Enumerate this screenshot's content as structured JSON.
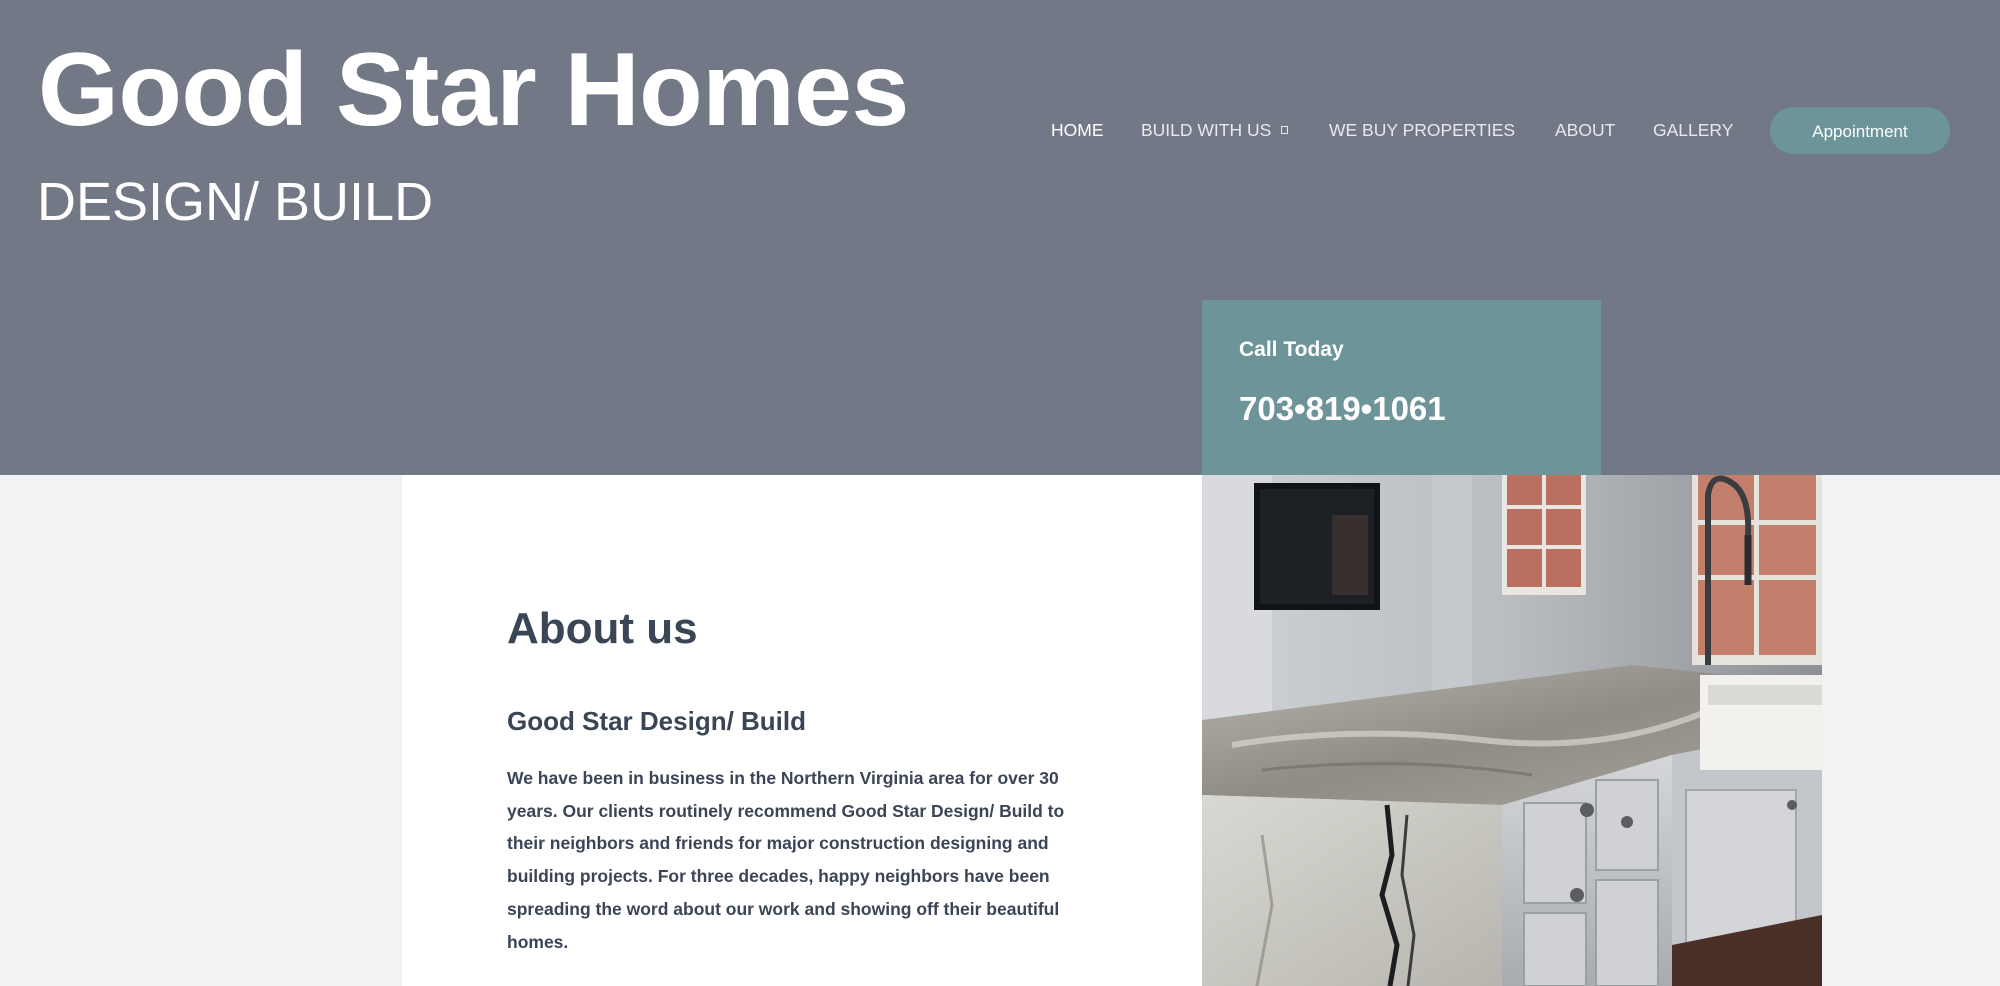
{
  "header": {
    "site_title": "Good Star Homes",
    "tagline": "DESIGN/ BUILD"
  },
  "nav": {
    "items": [
      {
        "label": "HOME",
        "active": true
      },
      {
        "label": "BUILD WITH US",
        "has_dropdown": true
      },
      {
        "label": "WE BUY PROPERTIES"
      },
      {
        "label": "ABOUT"
      },
      {
        "label": "GALLERY"
      }
    ],
    "cta_label": "Appointment"
  },
  "call_box": {
    "label": "Call Today",
    "phone": "703•819•1061"
  },
  "about": {
    "heading": "About us",
    "subheading": "Good Star Design/ Build",
    "body": "We have been in business in the Northern Virginia area for over 30\nyears.  Our clients routinely recommend Good Star Design/ Build to\ntheir neighbors and friends for major construction designing and\nbuilding projects.  For three decades, happy neighbors have been\nspreading the word about our work and showing off their beautiful\nhomes."
  },
  "colors": {
    "header_bg": "#727885",
    "accent": "#6d9499",
    "page_bg": "#f1f2f4",
    "heading_text": "#3a4556"
  },
  "icons": {
    "dropdown": "chevron-down-icon"
  }
}
